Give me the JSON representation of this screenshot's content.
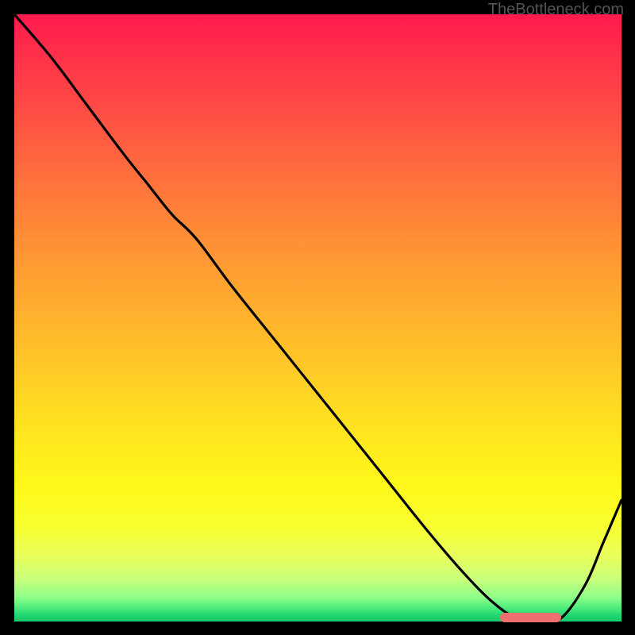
{
  "watermark": "TheBottleneck.com",
  "colors": {
    "curve": "#000000",
    "marker": "#ef6e6e",
    "background_top": "#ff1a4d",
    "background_bottom": "#17c968"
  },
  "chart_data": {
    "type": "line",
    "title": "",
    "xlabel": "",
    "ylabel": "",
    "xlim": [
      0,
      100
    ],
    "ylim": [
      0,
      100
    ],
    "grid": false,
    "series": [
      {
        "name": "curve",
        "x": [
          0,
          6,
          12,
          18,
          22,
          26,
          30,
          36,
          44,
          52,
          60,
          68,
          74,
          79,
          83,
          87,
          90,
          94,
          97,
          100
        ],
        "values": [
          100,
          93,
          85,
          77,
          72,
          67,
          63,
          55,
          45,
          35,
          25,
          15,
          8,
          3,
          0.5,
          0.3,
          0.5,
          6,
          13,
          20
        ]
      }
    ],
    "marker": {
      "x_start": 80,
      "x_end": 90,
      "y": 0.6
    }
  }
}
